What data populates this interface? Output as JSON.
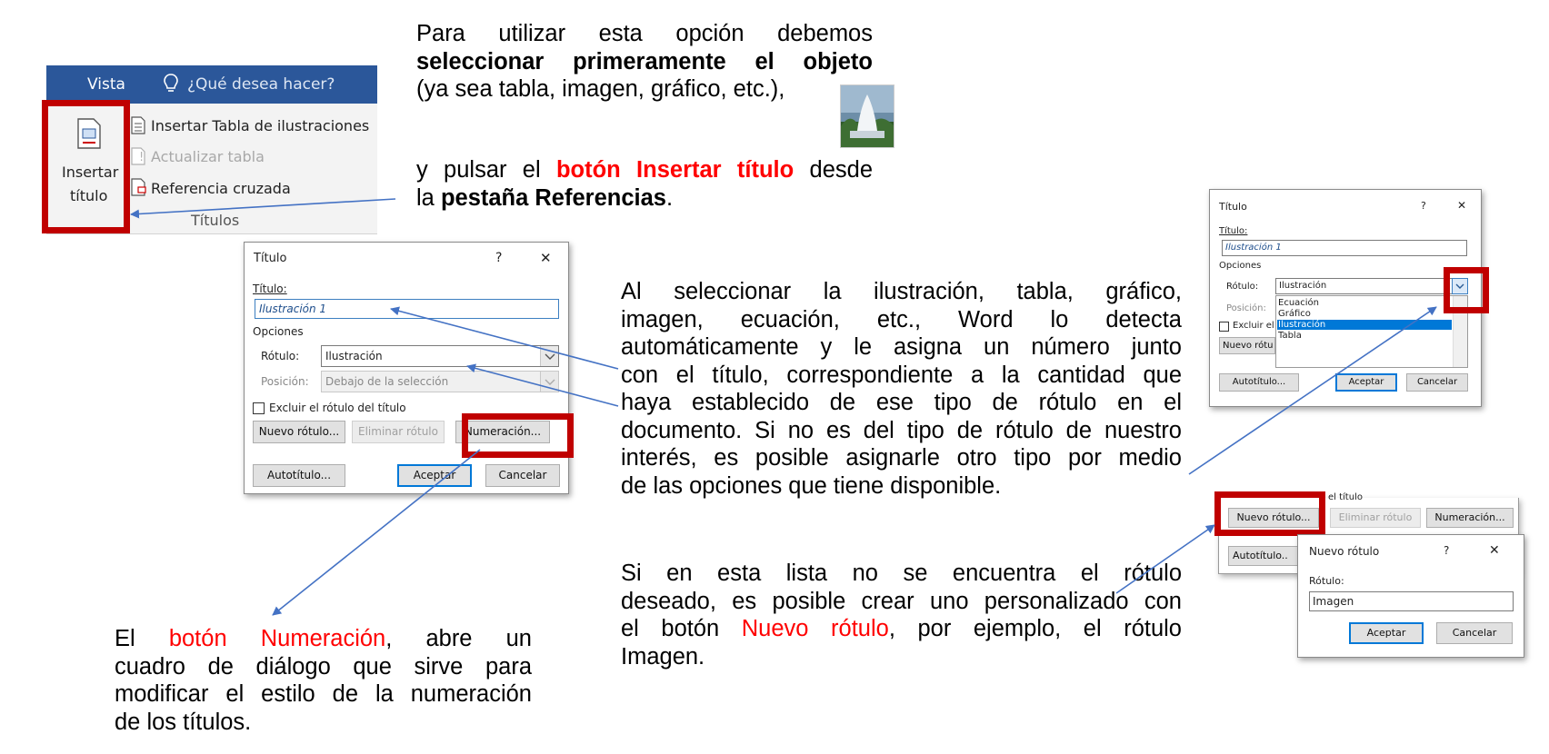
{
  "ribbon": {
    "tab_vista": "Vista",
    "tell_me": "¿Qué desea hacer?",
    "insert_caption_line1": "Insertar",
    "insert_caption_line2": "título",
    "insert_table_figures": "Insertar Tabla de ilustraciones",
    "update_table": "Actualizar tabla",
    "cross_reference": "Referencia cruzada",
    "group_name": "Títulos"
  },
  "intro_text": {
    "l1": "Para utilizar esta opción debemos",
    "l2": "seleccionar primeramente el objeto",
    "l3": "(ya sea tabla, imagen, gráfico, etc.),",
    "l4_a": "y pulsar el ",
    "l4_b": "botón Insertar título",
    "l4_c": " desde",
    "l5_a": "la ",
    "l5_b": "pestaña Referencias",
    "l5_c": "."
  },
  "caption_dialog": {
    "title": "Título",
    "help": "?",
    "close": "✕",
    "caption_label": "Título:",
    "caption_value": "Ilustración 1",
    "options_label": "Opciones",
    "label_label": "Rótulo:",
    "label_value": "Ilustración",
    "position_label": "Posición:",
    "position_value": "Debajo de la selección",
    "exclude_label": "Excluir el rótulo del título",
    "new_label_btn": "Nuevo rótulo...",
    "delete_label_btn": "Eliminar rótulo",
    "numbering_btn": "Numeración...",
    "autocaption_btn": "Autotítulo...",
    "ok_btn": "Aceptar",
    "cancel_btn": "Cancelar"
  },
  "middle_text": {
    "l1": "Al seleccionar la ilustración, tabla, gráfico,",
    "l2": "imagen, ecuación, etc., Word lo detecta",
    "l3": "automáticamente y le asigna un número junto",
    "l4": "con el título, correspondiente a la cantidad que",
    "l5": "haya establecido de ese tipo de rótulo en el",
    "l6": "documento. Si no es del tipo de rótulo de nuestro",
    "l7": "interés, es posible asignarle otro tipo por medio",
    "l8": "de las opciones que tiene disponible."
  },
  "numbering_text": {
    "l1_a": "El ",
    "l1_b": "botón Numeración",
    "l1_c": ", abre un",
    "l2": "cuadro de diálogo que sirve para",
    "l3": "modificar el estilo de la numeración",
    "l4": "de los títulos."
  },
  "newlabel_text": {
    "l1": "Si en esta lista no se encuentra el rótulo",
    "l2": "deseado, es posible crear uno personalizado con",
    "l3_a": "el botón ",
    "l3_b": "Nuevo rótulo",
    "l3_c": ", por ejemplo, el rótulo",
    "l4": "Imagen."
  },
  "small_dialog": {
    "title": "Título",
    "help": "?",
    "close": "✕",
    "caption_label": "Título:",
    "caption_value": "Ilustración 1",
    "options_label": "Opciones",
    "label_label": "Rótulo:",
    "label_value": "Ilustración",
    "position_label": "Posición:",
    "dropdown_options": [
      "Ecuación",
      "Gráfico",
      "Ilustración",
      "Tabla"
    ],
    "exclude_partial": "Excluir el",
    "new_label_partial": "Nuevo rótu",
    "autocaption_btn": "Autotítulo...",
    "ok_btn": "Aceptar",
    "cancel_btn": "Cancelar"
  },
  "bottom_dialog": {
    "partial_text": "el título",
    "new_label_btn": "Nuevo rótulo...",
    "delete_label_btn": "Eliminar rótulo",
    "numbering_btn": "Numeración...",
    "autocaption_partial": "Autotítulo..",
    "new_label_dialog": {
      "title": "Nuevo rótulo",
      "help": "?",
      "close": "✕",
      "label": "Rótulo:",
      "value": "Imagen",
      "ok_btn": "Aceptar",
      "cancel_btn": "Cancelar"
    }
  },
  "colors": {
    "highlight_box": "#c00000",
    "arrow": "#4472c4",
    "accent_red_text": "#ff0000",
    "ribbon_blue": "#2b579a",
    "selection_blue": "#0078d7"
  }
}
